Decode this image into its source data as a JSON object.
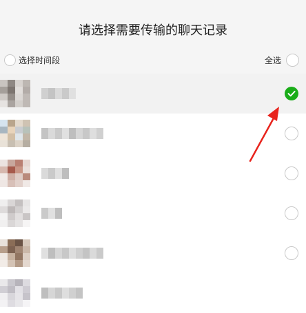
{
  "dialog": {
    "title": "请选择需要传输的聊天记录",
    "time_range_label": "选择时间段",
    "select_all_label": "全选"
  },
  "colors": {
    "check_green": "#1aad19",
    "arrow_red": "#e8231c"
  },
  "conversations": [
    {
      "selected": true,
      "name_blocks": 5
    },
    {
      "selected": false,
      "name_blocks": 9
    },
    {
      "selected": false,
      "name_blocks": 4
    },
    {
      "selected": false,
      "name_blocks": 3
    },
    {
      "selected": false,
      "name_blocks": 9
    },
    {
      "selected": false,
      "name_blocks": 6
    }
  ]
}
